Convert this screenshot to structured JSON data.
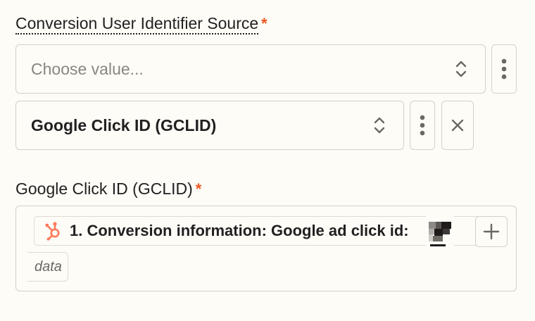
{
  "source_field": {
    "label": "Conversion User Identifier Source",
    "required_mark": "*",
    "placeholder_select": "Choose value...",
    "selected_value": "Google Click ID (GCLID)"
  },
  "gclid_field": {
    "label": "Google Click ID (GCLID)",
    "required_mark": "*",
    "mapped_pill": "1. Conversion information: Google ad click id:",
    "data_pill": "data"
  },
  "colors": {
    "accent": "#f0561d",
    "hubspot": "#ff7a59",
    "border": "#d3d0c6",
    "background": "#fdfcf7",
    "icon": "#6b6863"
  },
  "icons": {
    "select_chevron": "chevron-updown-icon",
    "more": "more-vertical-icon",
    "remove": "close-icon",
    "add": "plus-icon",
    "app": "hubspot-icon"
  }
}
